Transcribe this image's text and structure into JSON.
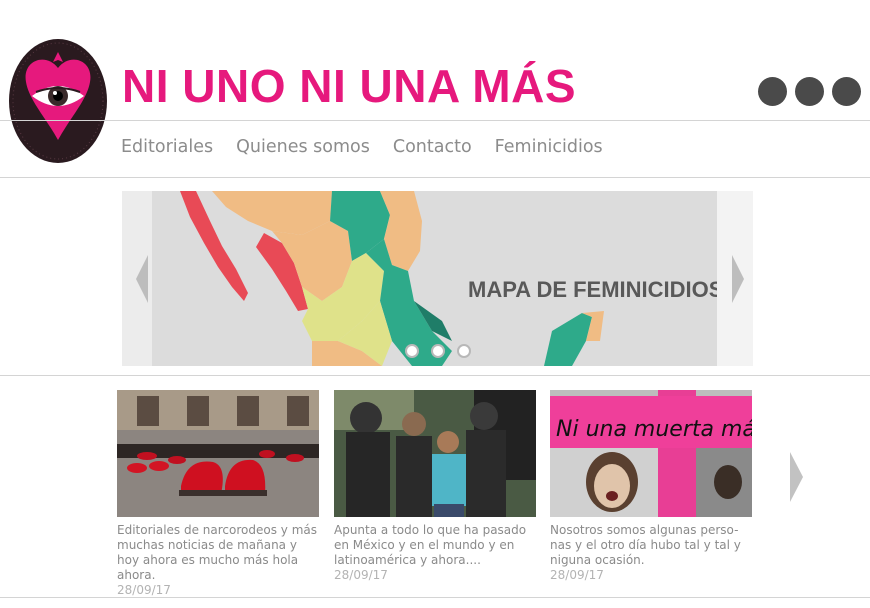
{
  "header": {
    "site_title": "NI UNO NI UNA MÁS",
    "logo_text": "NI UNO NI UNA MÁS",
    "more_menu_icon": "more-horizontal-icon",
    "brand_color": "#e6197d"
  },
  "nav": {
    "items": [
      {
        "label": "Editoriales"
      },
      {
        "label": "Quienes somos"
      },
      {
        "label": "Contacto"
      },
      {
        "label": "Feminicidios"
      }
    ]
  },
  "slider": {
    "caption": "MAPA DE FEMINICIDIOS",
    "slide_count": 3,
    "active_slide": 1
  },
  "articles": [
    {
      "description": "Editoriales de narcorodeos y más muchas noticias de mañana y hoy ahora es mucho más hola ahora.",
      "date": "28/09/17"
    },
    {
      "description": "Apunta a todo lo que ha pasado en México y en el mundo y en latinoamérica y ahora....",
      "date": "28/09/17"
    },
    {
      "description": "Nosotros somos algunas perso-nas y el otro día hubo tal y tal y niguna ocasión.",
      "date": "28/09/17",
      "image_text": "Ni una muerta más"
    }
  ]
}
